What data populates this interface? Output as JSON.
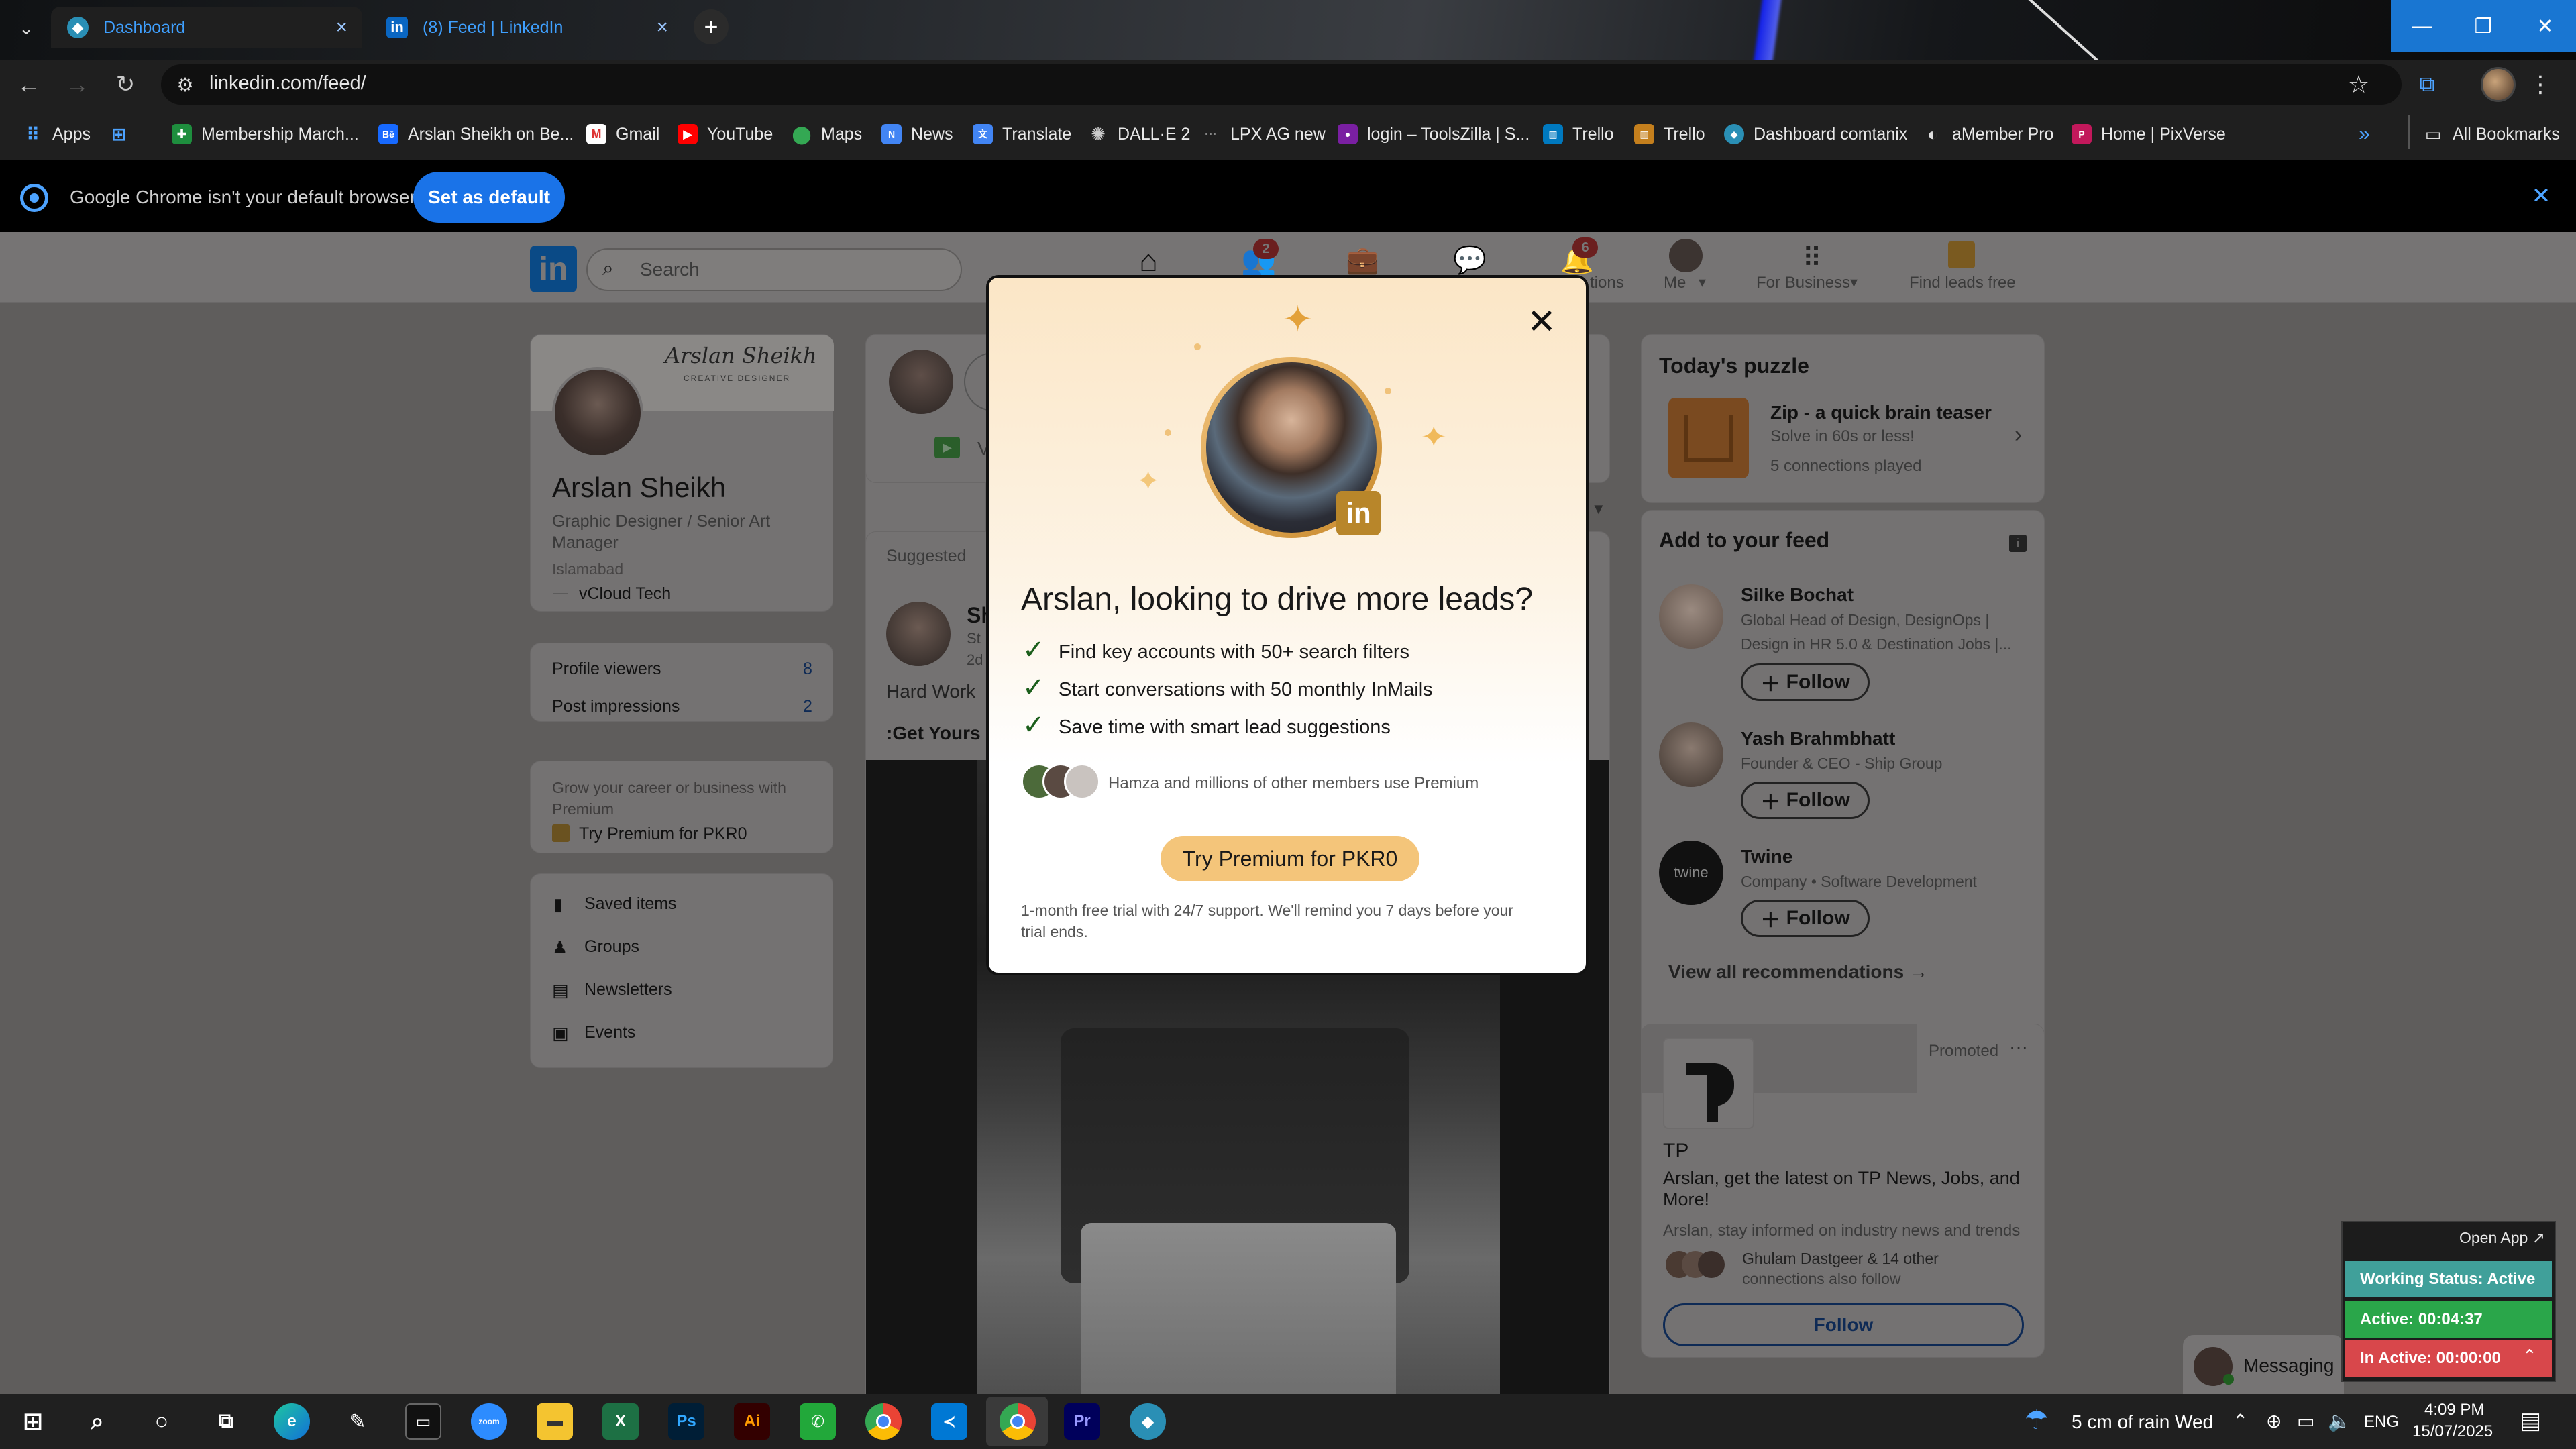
{
  "browser": {
    "tabs": [
      {
        "title": "Dashboard",
        "active": true
      },
      {
        "title": "(8) Feed | LinkedIn",
        "active": false
      }
    ],
    "url": "linkedin.com/feed/",
    "bookmarks": [
      {
        "label": "Apps",
        "icon": "apps-grid-icon"
      },
      {
        "label": "Membership March...",
        "icon": "bookmark-icon"
      },
      {
        "label": "Arslan Sheikh on Be...",
        "icon": "behance-icon"
      },
      {
        "label": "Gmail",
        "icon": "gmail-icon"
      },
      {
        "label": "YouTube",
        "icon": "youtube-icon"
      },
      {
        "label": "Maps",
        "icon": "maps-icon"
      },
      {
        "label": "News",
        "icon": "news-icon"
      },
      {
        "label": "Translate",
        "icon": "translate-icon"
      },
      {
        "label": "DALL·E 2",
        "icon": "openai-icon"
      },
      {
        "label": "LPX AG new",
        "icon": "dots-icon"
      },
      {
        "label": "login – ToolsZilla | S...",
        "icon": "toolszilla-icon"
      },
      {
        "label": "Trello",
        "icon": "trello-icon"
      },
      {
        "label": "Trello",
        "icon": "trello-icon"
      },
      {
        "label": "Dashboard comtanix",
        "icon": "comtanix-icon"
      },
      {
        "label": "aMember Pro",
        "icon": "amember-icon"
      },
      {
        "label": "Home | PixVerse",
        "icon": "pixverse-icon"
      }
    ],
    "all_bookmarks": "All Bookmarks",
    "infobar": {
      "message": "Google Chrome isn't your default browser",
      "button": "Set as default"
    }
  },
  "linkedin": {
    "search_placeholder": "Search",
    "nav": {
      "network_badge": "2",
      "notifications_badge": "6",
      "notifications_label_partial": "tions",
      "me": "Me",
      "for_business": "For Business",
      "find_leads": "Find leads free"
    },
    "profile": {
      "banner_text": "Arslan Sheikh",
      "banner_sub": "CREATIVE DESIGNER",
      "name": "Arslan Sheikh",
      "headline_1": "Graphic Designer / Senior Art",
      "headline_2": "Manager",
      "location": "Islamabad",
      "company": "vCloud Tech",
      "profile_viewers_label": "Profile viewers",
      "profile_viewers": "8",
      "post_impressions_label": "Post impressions",
      "post_impressions": "2",
      "grow_1": "Grow your career or business with",
      "grow_2": "Premium",
      "try_premium": "Try Premium for PKR0",
      "links": [
        "Saved items",
        "Groups",
        "Newsletters",
        "Events"
      ]
    },
    "feed": {
      "compose_partial": "V",
      "suggested": "Suggested",
      "post_author_partial": "Sh",
      "post_meta_1": "St",
      "post_meta_2": "2d",
      "post_text": "Hard Work",
      "post_bold": ":Get Yours N"
    },
    "puzzle": {
      "heading": "Today's puzzle",
      "title": "Zip - a quick brain teaser",
      "sub": "Solve in 60s or less!",
      "played": "5 connections played"
    },
    "add_to_feed": {
      "heading": "Add to your feed",
      "items": [
        {
          "name": "Silke Bochat",
          "desc1": "Global Head of Design, DesignOps |",
          "desc2": "Design in HR 5.0 & Destination Jobs |...",
          "follow": "Follow"
        },
        {
          "name": "Yash Brahmbhatt",
          "desc1": "Founder & CEO - Ship Group",
          "desc2": "",
          "follow": "Follow"
        },
        {
          "name": "Twine",
          "desc1": "Company • Software Development",
          "desc2": "",
          "follow": "Follow",
          "logo": "twine"
        }
      ],
      "view_all": "View all recommendations →"
    },
    "promoted": {
      "label": "Promoted",
      "company": "TP",
      "headline_1": "Arslan, get the latest on TP News, Jobs, and",
      "headline_2": "More!",
      "body": "Arslan, stay informed on industry news and trends",
      "connections_1": "Ghulam Dastgeer & 14 other",
      "connections_2": "connections also follow",
      "follow": "Follow"
    },
    "messaging": "Messaging"
  },
  "modal": {
    "title": "Arslan, looking to drive more leads?",
    "features": [
      "Find key accounts with 50+ search filters",
      "Start conversations with 50 monthly InMails",
      "Save time with smart lead suggestions"
    ],
    "social_proof": "Hamza and millions of other members use Premium",
    "cta": "Try Premium for PKR0",
    "fine_1": "1-month free trial with 24/7 support. We'll remind you 7 days before your",
    "fine_2": "trial ends.",
    "badge": "in"
  },
  "widget": {
    "open_app": "Open App ↗",
    "working": "Working Status: Active",
    "active": "Active: 00:04:37",
    "inactive": "In Active: 00:00:00",
    "colors": {
      "working": "#40a09a",
      "active": "#2aa64a",
      "inactive": "#d8474b"
    }
  },
  "taskbar": {
    "weather": "5 cm of rain Wed",
    "lang": "ENG",
    "time": "4:09 PM",
    "date": "15/07/2025",
    "apps": [
      "zoom",
      "Ps",
      "Ai",
      "Pr"
    ]
  }
}
